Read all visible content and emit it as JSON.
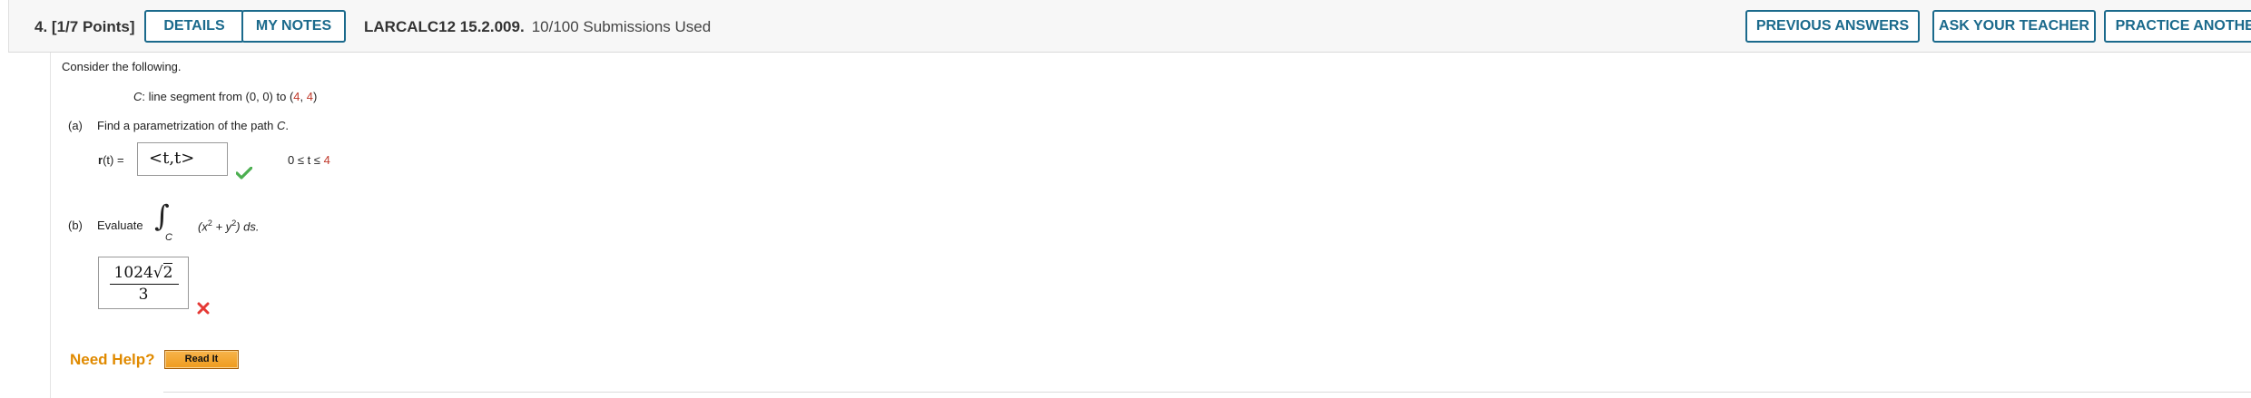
{
  "header": {
    "question_number": "4.",
    "points": "[1/7 Points]",
    "details_label": "DETAILS",
    "my_notes_label": "MY NOTES",
    "assignment_code": "LARCALC12 15.2.009.",
    "submissions": "10/100 Submissions Used",
    "previous_answers_label": "PREVIOUS ANSWERS",
    "ask_teacher_label": "ASK YOUR TEACHER",
    "practice_another_label": "PRACTICE ANOTHER"
  },
  "problem": {
    "intro": "Consider the following.",
    "curve": {
      "name": "C",
      "text": ": line segment from (0, 0) to (",
      "end_x": "4",
      "sep": ", ",
      "end_y": "4",
      "close": ")"
    },
    "part_a": {
      "label": "(a)",
      "prompt_pre": "Find a parametrization of the path ",
      "prompt_var": "C",
      "prompt_post": ".",
      "r_bold": "r",
      "r_rest": "(t) =",
      "answer": "<t,t>",
      "range_pre": "0 ≤ t ≤ ",
      "range_val": "4",
      "status": "correct"
    },
    "part_b": {
      "label": "(b)",
      "prompt": "Evaluate",
      "integral_sign": "∫",
      "integral_sub": "C",
      "integrand_pre": "(x",
      "sup1": "2",
      "integrand_mid": " + y",
      "sup2": "2",
      "integrand_post": ") ds.",
      "answer_num_coef": "1024",
      "answer_radical": "√",
      "answer_radicand": "2",
      "answer_den": "3",
      "status": "incorrect"
    }
  },
  "help": {
    "label": "Need Help?",
    "read_it_label": "Read It"
  },
  "colors": {
    "accent": "#1b6a8c",
    "highlight": "#c0392b",
    "help": "#e08a00",
    "correct": "#4caf50",
    "incorrect": "#e53935"
  }
}
